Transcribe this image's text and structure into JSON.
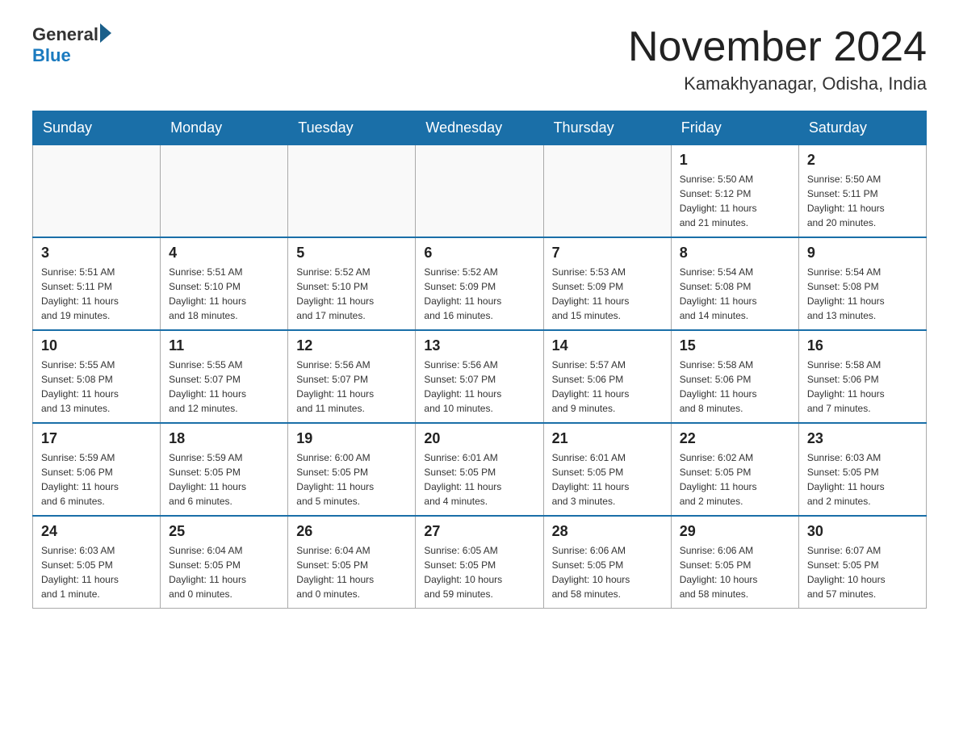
{
  "header": {
    "logo_text_general": "General",
    "logo_text_blue": "Blue",
    "main_title": "November 2024",
    "subtitle": "Kamakhyanagar, Odisha, India"
  },
  "days_of_week": [
    "Sunday",
    "Monday",
    "Tuesday",
    "Wednesday",
    "Thursday",
    "Friday",
    "Saturday"
  ],
  "weeks": [
    {
      "days": [
        {
          "number": "",
          "info": ""
        },
        {
          "number": "",
          "info": ""
        },
        {
          "number": "",
          "info": ""
        },
        {
          "number": "",
          "info": ""
        },
        {
          "number": "",
          "info": ""
        },
        {
          "number": "1",
          "info": "Sunrise: 5:50 AM\nSunset: 5:12 PM\nDaylight: 11 hours\nand 21 minutes."
        },
        {
          "number": "2",
          "info": "Sunrise: 5:50 AM\nSunset: 5:11 PM\nDaylight: 11 hours\nand 20 minutes."
        }
      ]
    },
    {
      "days": [
        {
          "number": "3",
          "info": "Sunrise: 5:51 AM\nSunset: 5:11 PM\nDaylight: 11 hours\nand 19 minutes."
        },
        {
          "number": "4",
          "info": "Sunrise: 5:51 AM\nSunset: 5:10 PM\nDaylight: 11 hours\nand 18 minutes."
        },
        {
          "number": "5",
          "info": "Sunrise: 5:52 AM\nSunset: 5:10 PM\nDaylight: 11 hours\nand 17 minutes."
        },
        {
          "number": "6",
          "info": "Sunrise: 5:52 AM\nSunset: 5:09 PM\nDaylight: 11 hours\nand 16 minutes."
        },
        {
          "number": "7",
          "info": "Sunrise: 5:53 AM\nSunset: 5:09 PM\nDaylight: 11 hours\nand 15 minutes."
        },
        {
          "number": "8",
          "info": "Sunrise: 5:54 AM\nSunset: 5:08 PM\nDaylight: 11 hours\nand 14 minutes."
        },
        {
          "number": "9",
          "info": "Sunrise: 5:54 AM\nSunset: 5:08 PM\nDaylight: 11 hours\nand 13 minutes."
        }
      ]
    },
    {
      "days": [
        {
          "number": "10",
          "info": "Sunrise: 5:55 AM\nSunset: 5:08 PM\nDaylight: 11 hours\nand 13 minutes."
        },
        {
          "number": "11",
          "info": "Sunrise: 5:55 AM\nSunset: 5:07 PM\nDaylight: 11 hours\nand 12 minutes."
        },
        {
          "number": "12",
          "info": "Sunrise: 5:56 AM\nSunset: 5:07 PM\nDaylight: 11 hours\nand 11 minutes."
        },
        {
          "number": "13",
          "info": "Sunrise: 5:56 AM\nSunset: 5:07 PM\nDaylight: 11 hours\nand 10 minutes."
        },
        {
          "number": "14",
          "info": "Sunrise: 5:57 AM\nSunset: 5:06 PM\nDaylight: 11 hours\nand 9 minutes."
        },
        {
          "number": "15",
          "info": "Sunrise: 5:58 AM\nSunset: 5:06 PM\nDaylight: 11 hours\nand 8 minutes."
        },
        {
          "number": "16",
          "info": "Sunrise: 5:58 AM\nSunset: 5:06 PM\nDaylight: 11 hours\nand 7 minutes."
        }
      ]
    },
    {
      "days": [
        {
          "number": "17",
          "info": "Sunrise: 5:59 AM\nSunset: 5:06 PM\nDaylight: 11 hours\nand 6 minutes."
        },
        {
          "number": "18",
          "info": "Sunrise: 5:59 AM\nSunset: 5:05 PM\nDaylight: 11 hours\nand 6 minutes."
        },
        {
          "number": "19",
          "info": "Sunrise: 6:00 AM\nSunset: 5:05 PM\nDaylight: 11 hours\nand 5 minutes."
        },
        {
          "number": "20",
          "info": "Sunrise: 6:01 AM\nSunset: 5:05 PM\nDaylight: 11 hours\nand 4 minutes."
        },
        {
          "number": "21",
          "info": "Sunrise: 6:01 AM\nSunset: 5:05 PM\nDaylight: 11 hours\nand 3 minutes."
        },
        {
          "number": "22",
          "info": "Sunrise: 6:02 AM\nSunset: 5:05 PM\nDaylight: 11 hours\nand 2 minutes."
        },
        {
          "number": "23",
          "info": "Sunrise: 6:03 AM\nSunset: 5:05 PM\nDaylight: 11 hours\nand 2 minutes."
        }
      ]
    },
    {
      "days": [
        {
          "number": "24",
          "info": "Sunrise: 6:03 AM\nSunset: 5:05 PM\nDaylight: 11 hours\nand 1 minute."
        },
        {
          "number": "25",
          "info": "Sunrise: 6:04 AM\nSunset: 5:05 PM\nDaylight: 11 hours\nand 0 minutes."
        },
        {
          "number": "26",
          "info": "Sunrise: 6:04 AM\nSunset: 5:05 PM\nDaylight: 11 hours\nand 0 minutes."
        },
        {
          "number": "27",
          "info": "Sunrise: 6:05 AM\nSunset: 5:05 PM\nDaylight: 10 hours\nand 59 minutes."
        },
        {
          "number": "28",
          "info": "Sunrise: 6:06 AM\nSunset: 5:05 PM\nDaylight: 10 hours\nand 58 minutes."
        },
        {
          "number": "29",
          "info": "Sunrise: 6:06 AM\nSunset: 5:05 PM\nDaylight: 10 hours\nand 58 minutes."
        },
        {
          "number": "30",
          "info": "Sunrise: 6:07 AM\nSunset: 5:05 PM\nDaylight: 10 hours\nand 57 minutes."
        }
      ]
    }
  ]
}
